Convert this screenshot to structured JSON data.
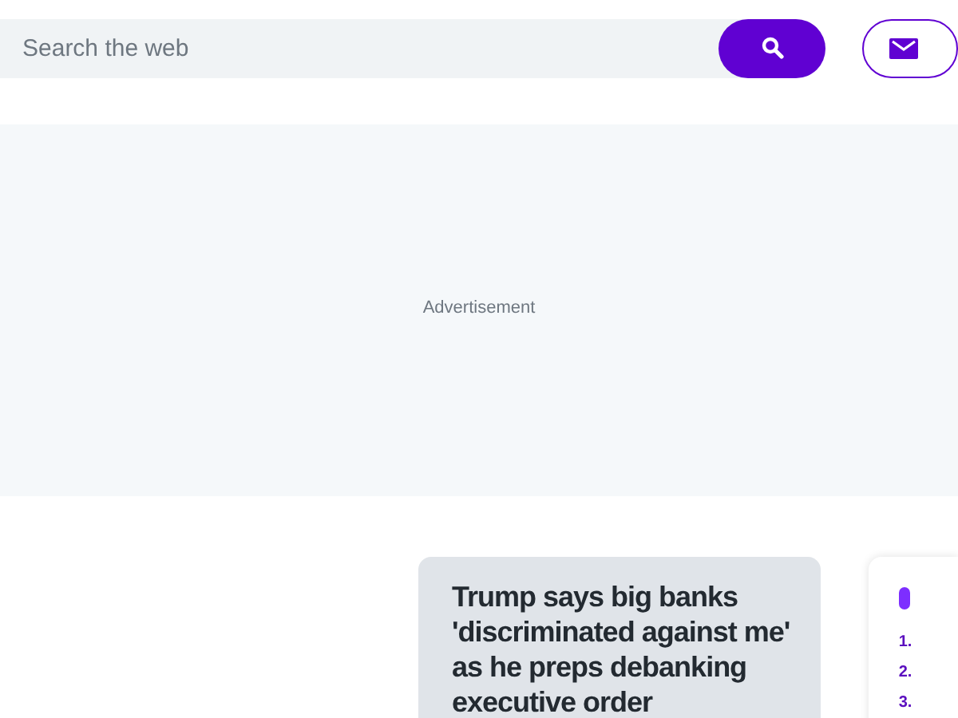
{
  "search": {
    "placeholder": "Search the web"
  },
  "ad": {
    "label": "Advertisement"
  },
  "headline": {
    "title": "Trump says big banks 'discriminated against me' as he preps debanking executive order"
  },
  "trending": {
    "items": [
      {
        "rank": "1."
      },
      {
        "rank": "2."
      },
      {
        "rank": "3."
      }
    ]
  }
}
